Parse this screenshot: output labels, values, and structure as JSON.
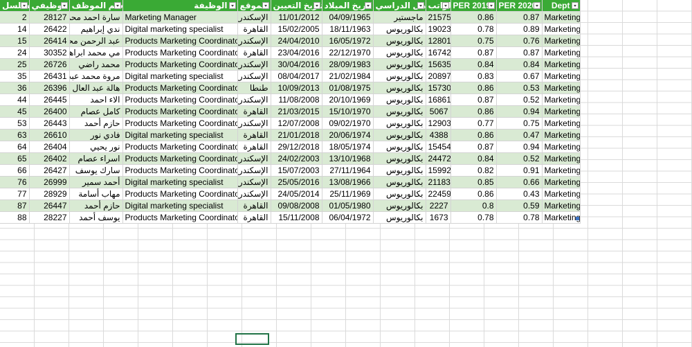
{
  "headers": {
    "serial": "مسلسل",
    "job_number": "الرقم الوظيفي",
    "employee_name": "اسم الموظف",
    "job_title": "الوظيفة",
    "location": "الموقع",
    "hire_date": "تاريخ التعيين",
    "birth_date": "تاريخ الميلاد",
    "qualification": "المؤهل الدراسي",
    "salary": "الراتب",
    "per2019": "PER 2019",
    "per2020": "PER 2020",
    "dept": "Dept"
  },
  "rows": [
    {
      "serial": "2",
      "job_number": "28127",
      "employee_name": "سارة احمد محمد",
      "job_title": "Marketing Manager",
      "location": "الإسكندرية",
      "hire_date": "11/01/2012",
      "birth_date": "04/09/1965",
      "qualification": "ماجستير",
      "salary": "21575",
      "per2019": "0.86",
      "per2020": "0.87",
      "dept": "Marketing"
    },
    {
      "serial": "14",
      "job_number": "26422",
      "employee_name": "ندي إبراهيم",
      "job_title": "Digital marketing specialist",
      "location": "القاهرة",
      "hire_date": "15/02/2005",
      "birth_date": "18/11/1963",
      "qualification": "بكالوريوس",
      "salary": "19023",
      "per2019": "0.78",
      "per2020": "0.89",
      "dept": "Marketing"
    },
    {
      "serial": "15",
      "job_number": "26414",
      "employee_name": "عبد الرحمن محمد",
      "job_title": "Products Marketing Coordinator",
      "location": "الإسكندرية",
      "hire_date": "24/04/2010",
      "birth_date": "16/05/1972",
      "qualification": "بكالوريوس",
      "salary": "12801",
      "per2019": "0.75",
      "per2020": "0.76",
      "dept": "Marketing"
    },
    {
      "serial": "24",
      "job_number": "30352",
      "employee_name": "مي محمد ابراهيم",
      "job_title": "Products Marketing Coordinator",
      "location": "القاهرة",
      "hire_date": "23/04/2016",
      "birth_date": "22/12/1970",
      "qualification": "بكالوريوس",
      "salary": "16742",
      "per2019": "0.87",
      "per2020": "0.87",
      "dept": "Marketing"
    },
    {
      "serial": "25",
      "job_number": "26726",
      "employee_name": "محمد راضي",
      "job_title": "Products Marketing Coordinator",
      "location": "الإسكندرية",
      "hire_date": "30/04/2016",
      "birth_date": "28/09/1983",
      "qualification": "بكالوريوس",
      "salary": "15635",
      "per2019": "0.84",
      "per2020": "0.84",
      "dept": "Marketing"
    },
    {
      "serial": "35",
      "job_number": "26431",
      "employee_name": "مروة محمد عبدالله",
      "job_title": "Digital marketing specialist",
      "location": "الإسكندرية",
      "hire_date": "08/04/2017",
      "birth_date": "21/02/1984",
      "qualification": "بكالوريوس",
      "salary": "20897",
      "per2019": "0.83",
      "per2020": "0.67",
      "dept": "Marketing"
    },
    {
      "serial": "36",
      "job_number": "26396",
      "employee_name": "هالة عبد العال",
      "job_title": "Products Marketing Coordinator",
      "location": "طنطا",
      "hire_date": "10/09/2013",
      "birth_date": "01/08/1975",
      "qualification": "بكالوريوس",
      "salary": "15730",
      "per2019": "0.86",
      "per2020": "0.53",
      "dept": "Marketing"
    },
    {
      "serial": "44",
      "job_number": "26445",
      "employee_name": "الاء احمد",
      "job_title": "Products Marketing Coordinator",
      "location": "الإسكندرية",
      "hire_date": "11/08/2008",
      "birth_date": "20/10/1969",
      "qualification": "بكالوريوس",
      "salary": "16861",
      "per2019": "0.87",
      "per2020": "0.52",
      "dept": "Marketing"
    },
    {
      "serial": "45",
      "job_number": "26400",
      "employee_name": "كامل عصام",
      "job_title": "Products Marketing Coordinator",
      "location": "القاهرة",
      "hire_date": "21/03/2015",
      "birth_date": "15/10/1970",
      "qualification": "بكالوريوس",
      "salary": "5067",
      "per2019": "0.86",
      "per2020": "0.94",
      "dept": "Marketing"
    },
    {
      "serial": "53",
      "job_number": "26443",
      "employee_name": "حازم أحمد",
      "job_title": "Products Marketing Coordinator",
      "location": "الإسكندرية",
      "hire_date": "12/07/2008",
      "birth_date": "09/02/1970",
      "qualification": "بكالوريوس",
      "salary": "12903",
      "per2019": "0.77",
      "per2020": "0.75",
      "dept": "Marketing"
    },
    {
      "serial": "63",
      "job_number": "26610",
      "employee_name": "فادي نور",
      "job_title": "Digital marketing specialist",
      "location": "القاهرة",
      "hire_date": "21/01/2018",
      "birth_date": "20/06/1974",
      "qualification": "بكالوريوس",
      "salary": "4388",
      "per2019": "0.86",
      "per2020": "0.47",
      "dept": "Marketing"
    },
    {
      "serial": "64",
      "job_number": "26404",
      "employee_name": "نور يحيي",
      "job_title": "Products Marketing Coordinator",
      "location": "القاهرة",
      "hire_date": "29/12/2018",
      "birth_date": "18/05/1974",
      "qualification": "بكالوريوس",
      "salary": "15454",
      "per2019": "0.87",
      "per2020": "0.94",
      "dept": "Marketing"
    },
    {
      "serial": "65",
      "job_number": "26402",
      "employee_name": "اسراء عصام",
      "job_title": "Products Marketing Coordinator",
      "location": "الإسكندرية",
      "hire_date": "24/02/2003",
      "birth_date": "13/10/1968",
      "qualification": "بكالوريوس",
      "salary": "24472",
      "per2019": "0.84",
      "per2020": "0.52",
      "dept": "Marketing"
    },
    {
      "serial": "66",
      "job_number": "26427",
      "employee_name": "سارك يوسف",
      "job_title": "Products Marketing Coordinator",
      "location": "الإسكندرية",
      "hire_date": "15/07/2003",
      "birth_date": "27/11/1964",
      "qualification": "بكالوريوس",
      "salary": "15992",
      "per2019": "0.82",
      "per2020": "0.91",
      "dept": "Marketing"
    },
    {
      "serial": "76",
      "job_number": "26999",
      "employee_name": "أحمد سمير",
      "job_title": "Digital marketing specialist",
      "location": "الإسكندرية",
      "hire_date": "25/05/2016",
      "birth_date": "13/08/1966",
      "qualification": "بكالوريوس",
      "salary": "21183",
      "per2019": "0.85",
      "per2020": "0.66",
      "dept": "Marketing"
    },
    {
      "serial": "77",
      "job_number": "28929",
      "employee_name": "مهاب أسامة",
      "job_title": "Products Marketing Coordinator",
      "location": "الإسكندرية",
      "hire_date": "24/05/2014",
      "birth_date": "25/11/1969",
      "qualification": "بكالوريوس",
      "salary": "22459",
      "per2019": "0.86",
      "per2020": "0.43",
      "dept": "Marketing"
    },
    {
      "serial": "87",
      "job_number": "26447",
      "employee_name": "حازم أحمد",
      "job_title": "Digital marketing specialist",
      "location": "القاهرة",
      "hire_date": "09/08/2008",
      "birth_date": "01/05/1980",
      "qualification": "بكالوريوس",
      "salary": "2227",
      "per2019": "0.8",
      "per2020": "0.59",
      "dept": "Marketing"
    },
    {
      "serial": "88",
      "job_number": "28227",
      "employee_name": "يوسف أحمد",
      "job_title": "Products Marketing Coordinator",
      "location": "القاهرة",
      "hire_date": "15/11/2008",
      "birth_date": "06/04/1972",
      "qualification": "بكالوريوس",
      "salary": "1673",
      "per2019": "0.78",
      "per2020": "0.78",
      "dept": "Marketing"
    }
  ],
  "colors": {
    "header_bg": "#3aaa35",
    "band_bg": "#d9ead3",
    "selection_border": "#217346"
  }
}
